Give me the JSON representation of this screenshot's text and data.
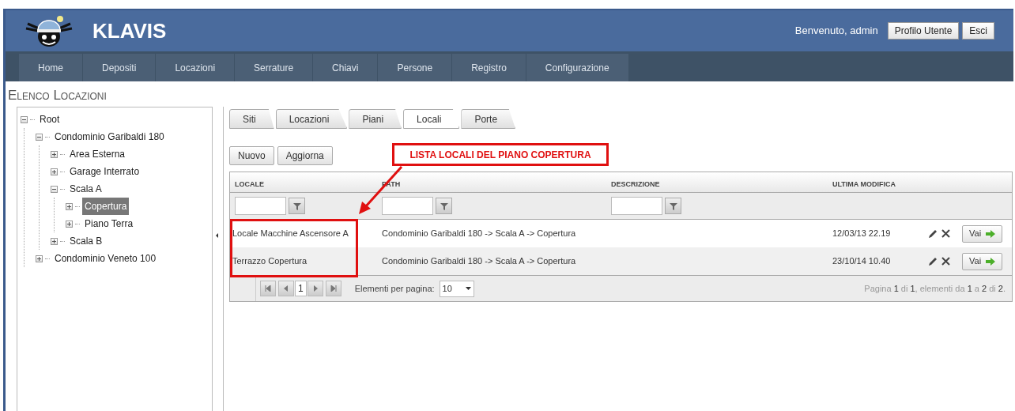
{
  "header": {
    "app_name": "KLAVIS",
    "welcome": "Benvenuto, admin",
    "buttons": [
      "Profilo Utente",
      "Esci"
    ]
  },
  "nav": [
    "Home",
    "Depositi",
    "Locazioni",
    "Serrature",
    "Chiavi",
    "Persone",
    "Registro",
    "Configurazione"
  ],
  "page_title": "Elenco Locazioni",
  "tree": [
    {
      "label": "Root",
      "expanded": true,
      "selected": false,
      "children": [
        {
          "label": "Condominio Garibaldi 180",
          "expanded": true,
          "selected": false,
          "children": [
            {
              "label": "Area Esterna",
              "expanded": false,
              "selected": false
            },
            {
              "label": "Garage Interrato",
              "expanded": false,
              "selected": false
            },
            {
              "label": "Scala A",
              "expanded": true,
              "selected": false,
              "children": [
                {
                  "label": "Copertura",
                  "expanded": false,
                  "selected": true
                },
                {
                  "label": "Piano Terra",
                  "expanded": false,
                  "selected": false
                }
              ]
            },
            {
              "label": "Scala B",
              "expanded": false,
              "selected": false
            }
          ]
        },
        {
          "label": "Condominio Veneto 100",
          "expanded": false,
          "selected": false
        }
      ]
    }
  ],
  "tabs": [
    {
      "label": "Siti",
      "selected": false
    },
    {
      "label": "Locazioni",
      "selected": false
    },
    {
      "label": "Piani",
      "selected": false
    },
    {
      "label": "Locali",
      "selected": true
    },
    {
      "label": "Porte",
      "selected": false
    }
  ],
  "toolbar_buttons": [
    "Nuovo",
    "Aggiorna"
  ],
  "table": {
    "columns": [
      {
        "label": "LOCALE",
        "filter": true
      },
      {
        "label": "PATH",
        "filter": true
      },
      {
        "label": "DESCRIZIONE",
        "filter": true
      },
      {
        "label": "ULTIMA MODIFICA",
        "filter": false
      }
    ],
    "rows": [
      {
        "locale": "Locale Macchine Ascensore A",
        "path": "Condominio Garibaldi 180 -> Scala A -> Copertura",
        "modified": "12/03/13 22.19",
        "action": "Vai"
      },
      {
        "locale": "Terrazzo Copertura",
        "path": "Condominio Garibaldi 180 -> Scala A -> Copertura",
        "modified": "23/10/14 10.40",
        "action": "Vai"
      }
    ]
  },
  "pager": {
    "page": "1",
    "page_size_label": "Elementi per pagina:",
    "page_size": "10",
    "info": "Pagina **1** di **1**, elementi da **1** a **2** di **2**."
  },
  "annotation": {
    "label": "LISTA LOCALI DEL PIANO COPERTURA"
  }
}
